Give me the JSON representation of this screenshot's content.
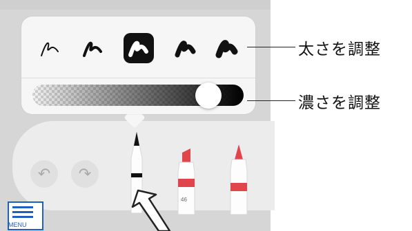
{
  "thickness_options": [
    {
      "id": "thinnest",
      "selected": false
    },
    {
      "id": "thin",
      "selected": false
    },
    {
      "id": "medium",
      "selected": true
    },
    {
      "id": "thick",
      "selected": false
    },
    {
      "id": "thickest",
      "selected": false
    }
  ],
  "opacity": {
    "value": 0.88
  },
  "callouts": {
    "thickness": "太さを調整",
    "opacity": "濃さを調整"
  },
  "toolbar": {
    "undo_icon": "undo-icon",
    "redo_icon": "redo-icon",
    "tools": [
      {
        "name": "pen",
        "color": "#111111",
        "selected": true
      },
      {
        "name": "marker",
        "color": "#e0454b",
        "label": "46"
      },
      {
        "name": "pencil",
        "color": "#e0454b"
      }
    ]
  },
  "menu": {
    "label": "MENU"
  },
  "colors": {
    "accent": "#1f5fbf",
    "marker_red": "#e0454b",
    "selected_bg": "#111111"
  }
}
